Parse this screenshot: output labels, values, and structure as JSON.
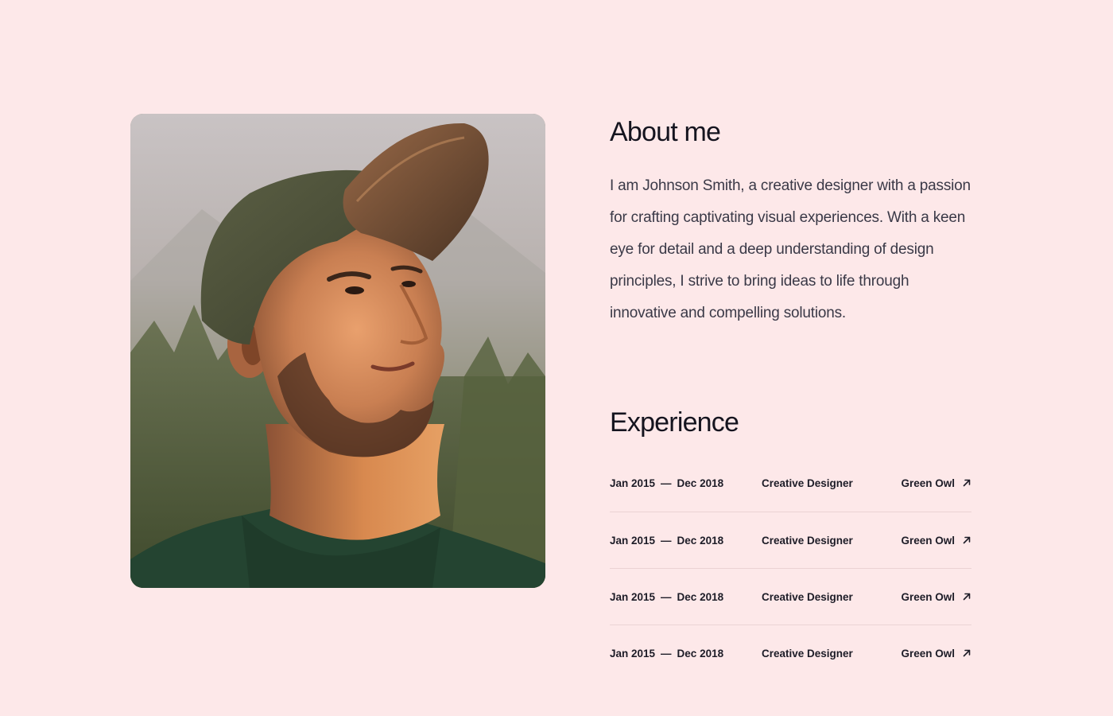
{
  "about": {
    "heading": "About me",
    "bio": "I am Johnson Smith, a creative designer with a passion for crafting captivating visual experiences. With a keen eye for detail and a deep understanding of design principles, I strive to bring ideas to life through innovative and compelling solutions."
  },
  "experience": {
    "heading": "Experience",
    "items": [
      {
        "start": "Jan 2015",
        "separator": "—",
        "end": "Dec 2018",
        "role": "Creative Designer",
        "company": "Green Owl",
        "icon": "arrow-up-right-icon"
      },
      {
        "start": "Jan 2015",
        "separator": "—",
        "end": "Dec 2018",
        "role": "Creative Designer",
        "company": "Green Owl",
        "icon": "arrow-up-right-icon"
      },
      {
        "start": "Jan 2015",
        "separator": "—",
        "end": "Dec 2018",
        "role": "Creative Designer",
        "company": "Green Owl",
        "icon": "arrow-up-right-icon"
      },
      {
        "start": "Jan 2015",
        "separator": "—",
        "end": "Dec 2018",
        "role": "Creative Designer",
        "company": "Green Owl",
        "icon": "arrow-up-right-icon"
      }
    ]
  },
  "colors": {
    "background": "#fde8e9",
    "text": "#15141f",
    "body_text": "#3a3947",
    "divider": "#ebd3d4"
  }
}
